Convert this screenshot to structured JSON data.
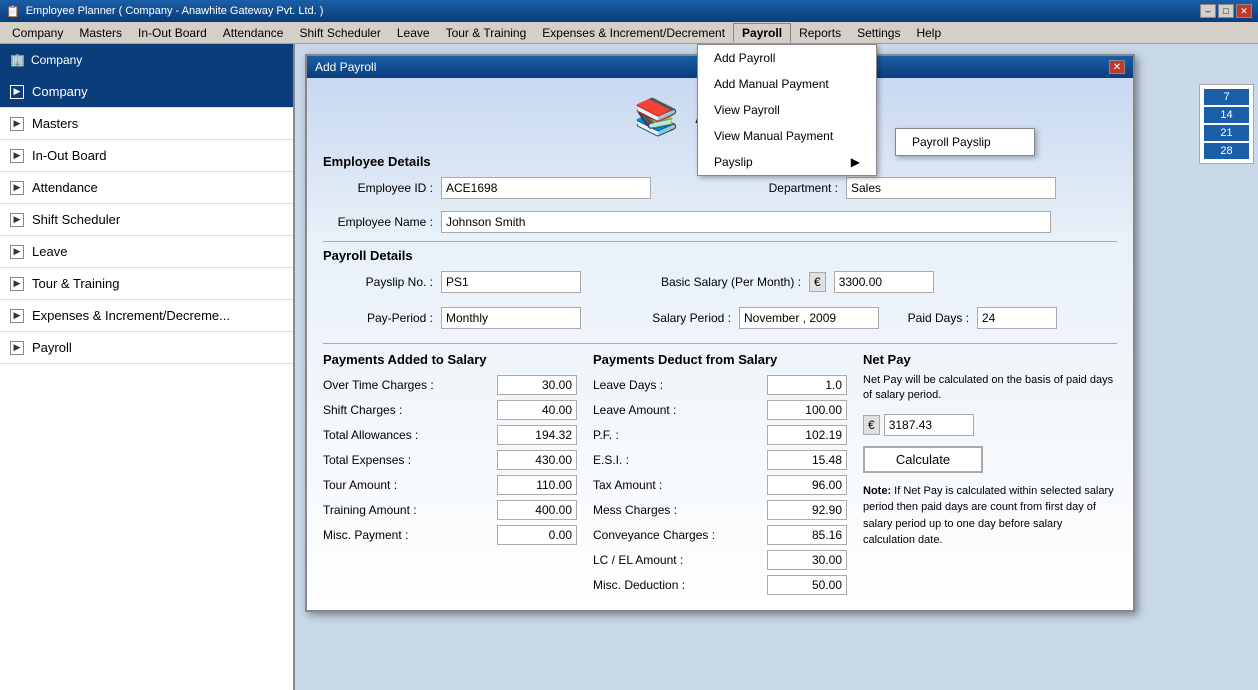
{
  "app": {
    "title": "Employee Planner ( Company - Anawhite Gateway Pvt. Ltd. )",
    "title_icon": "📋"
  },
  "titlebar_controls": {
    "minimize": "–",
    "maximize": "□",
    "close": "✕"
  },
  "menubar": {
    "items": [
      {
        "id": "company",
        "label": "Company"
      },
      {
        "id": "masters",
        "label": "Masters"
      },
      {
        "id": "inout",
        "label": "In-Out Board"
      },
      {
        "id": "attendance",
        "label": "Attendance"
      },
      {
        "id": "shift",
        "label": "Shift Scheduler"
      },
      {
        "id": "leave",
        "label": "Leave"
      },
      {
        "id": "tour",
        "label": "Tour & Training"
      },
      {
        "id": "expenses",
        "label": "Expenses & Increment/Decrement"
      },
      {
        "id": "payroll",
        "label": "Payroll"
      },
      {
        "id": "reports",
        "label": "Reports"
      },
      {
        "id": "settings",
        "label": "Settings"
      },
      {
        "id": "help",
        "label": "Help"
      }
    ]
  },
  "payroll_menu": {
    "items": [
      {
        "id": "add_payroll",
        "label": "Add Payroll"
      },
      {
        "id": "add_manual",
        "label": "Add Manual Payment"
      },
      {
        "id": "view_payroll",
        "label": "View Payroll"
      },
      {
        "id": "view_manual",
        "label": "View Manual Payment"
      },
      {
        "id": "payslip",
        "label": "Payslip",
        "has_submenu": true
      }
    ],
    "payslip_submenu": [
      {
        "id": "payroll_payslip",
        "label": "Payroll Payslip"
      }
    ]
  },
  "sidebar": {
    "top_label": "Company",
    "items": [
      {
        "id": "company",
        "label": "Company",
        "active": true
      },
      {
        "id": "masters",
        "label": "Masters"
      },
      {
        "id": "inout_board",
        "label": "In-Out Board"
      },
      {
        "id": "attendance",
        "label": "Attendance"
      },
      {
        "id": "shift_scheduler",
        "label": "Shift Scheduler"
      },
      {
        "id": "leave",
        "label": "Leave"
      },
      {
        "id": "tour_training",
        "label": "Tour & Training"
      },
      {
        "id": "expenses",
        "label": "Expenses & Increment/Decreme..."
      },
      {
        "id": "payroll",
        "label": "Payroll"
      }
    ]
  },
  "dialog": {
    "title": "Add Payroll",
    "heading": "Add Payroll",
    "employee_details_label": "Employee Details",
    "employee_id_label": "Employee ID :",
    "employee_id_value": "ACE1698",
    "department_label": "Department :",
    "department_value": "Sales",
    "employee_name_label": "Employee Name :",
    "employee_name_value": "Johnson Smith",
    "payroll_details_label": "Payroll Details",
    "payslip_no_label": "Payslip No. :",
    "payslip_no_value": "PS1",
    "basic_salary_label": "Basic Salary (Per Month) :",
    "basic_salary_currency": "€",
    "basic_salary_value": "3300.00",
    "pay_period_label": "Pay-Period :",
    "pay_period_value": "Monthly",
    "salary_period_label": "Salary Period :",
    "salary_period_value": "November , 2009",
    "paid_days_label": "Paid Days :",
    "paid_days_value": "24",
    "payments_added_title": "Payments Added to Salary",
    "payments_added": [
      {
        "label": "Over Time Charges :",
        "value": "30.00"
      },
      {
        "label": "Shift Charges :",
        "value": "40.00"
      },
      {
        "label": "Total Allowances :",
        "value": "194.32"
      },
      {
        "label": "Total Expenses :",
        "value": "430.00"
      },
      {
        "label": "Tour Amount :",
        "value": "110.00"
      },
      {
        "label": "Training Amount :",
        "value": "400.00"
      },
      {
        "label": "Misc. Payment :",
        "value": "0.00"
      }
    ],
    "payments_deduct_title": "Payments Deduct from Salary",
    "payments_deducted": [
      {
        "label": "Leave Days :",
        "value": "1.0"
      },
      {
        "label": "Leave Amount :",
        "value": "100.00"
      },
      {
        "label": "P.F. :",
        "value": "102.19"
      },
      {
        "label": "E.S.I. :",
        "value": "15.48"
      },
      {
        "label": "Tax Amount :",
        "value": "96.00"
      },
      {
        "label": "Mess Charges :",
        "value": "92.90"
      },
      {
        "label": "Conveyance Charges :",
        "value": "85.16"
      },
      {
        "label": "LC / EL Amount :",
        "value": "30.00"
      },
      {
        "label": "Misc. Deduction :",
        "value": "50.00"
      }
    ],
    "net_pay_title": "Net Pay",
    "net_pay_desc": "Net Pay will be calculated on the basis of paid days of salary period.",
    "net_pay_currency": "€",
    "net_pay_value": "3187.43",
    "calculate_btn": "Calculate",
    "note_label": "Note:",
    "note_text": "If Net Pay is calculated within selected salary period then paid days are count from first day of salary period up to one day before salary calculation date."
  },
  "calendar": {
    "days": [
      "7",
      "14",
      "21",
      "28"
    ]
  }
}
